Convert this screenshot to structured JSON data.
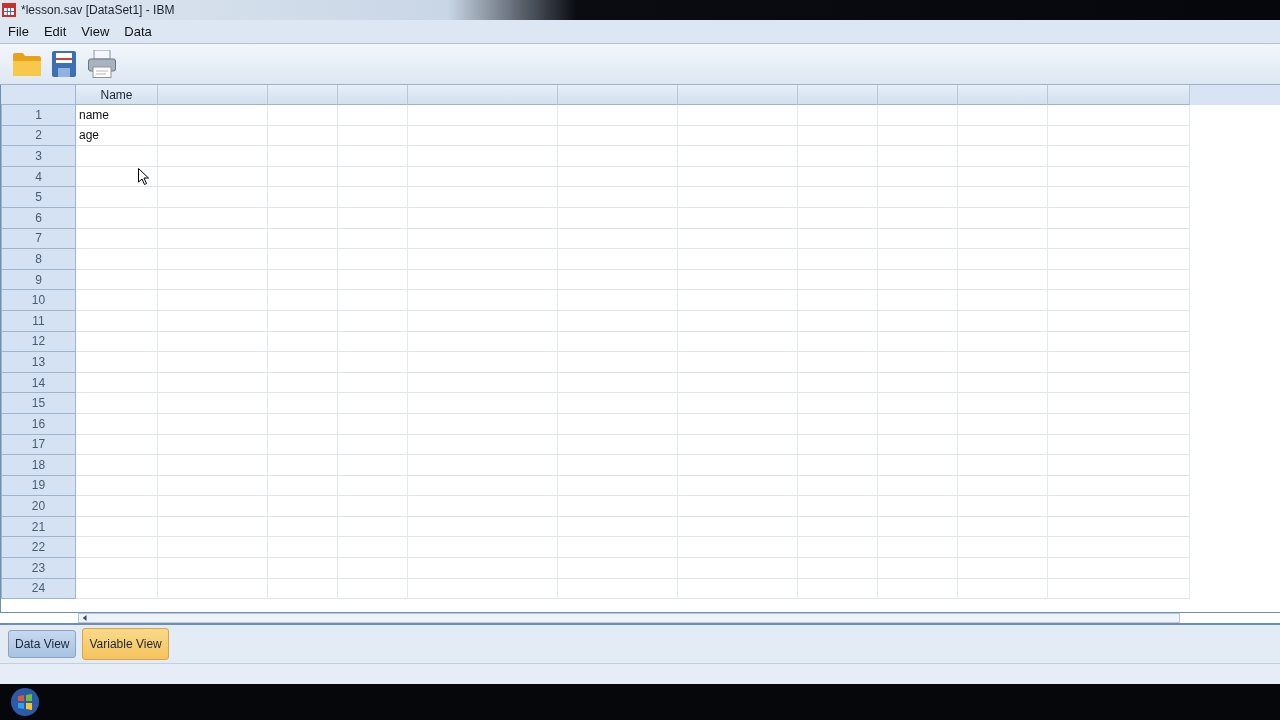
{
  "window": {
    "title": "*lesson.sav [DataSet1] - IBM"
  },
  "menu": [
    "File",
    "Edit",
    "View",
    "Data"
  ],
  "toolbar": [
    {
      "kind": "open"
    },
    {
      "kind": "save"
    },
    {
      "kind": "print"
    }
  ],
  "grid": {
    "columns": [
      "Name"
    ],
    "rows": [
      {
        "number": "1",
        "name": "name"
      },
      {
        "number": "2",
        "name": "age"
      },
      {
        "number": "3"
      },
      {
        "number": "4"
      },
      {
        "number": "5"
      },
      {
        "number": "6"
      },
      {
        "number": "7"
      },
      {
        "number": "8"
      },
      {
        "number": "9"
      },
      {
        "number": "10"
      },
      {
        "number": "11"
      },
      {
        "number": "12"
      },
      {
        "number": "13"
      },
      {
        "number": "14"
      },
      {
        "number": "15"
      },
      {
        "number": "16"
      },
      {
        "number": "17"
      },
      {
        "number": "18"
      },
      {
        "number": "19"
      },
      {
        "number": "20"
      },
      {
        "number": "21"
      },
      {
        "number": "22"
      },
      {
        "number": "23"
      },
      {
        "number": "24"
      }
    ]
  },
  "tabs": [
    {
      "label": "Data View",
      "selected": false
    },
    {
      "label": "Variable View",
      "selected": true
    }
  ]
}
